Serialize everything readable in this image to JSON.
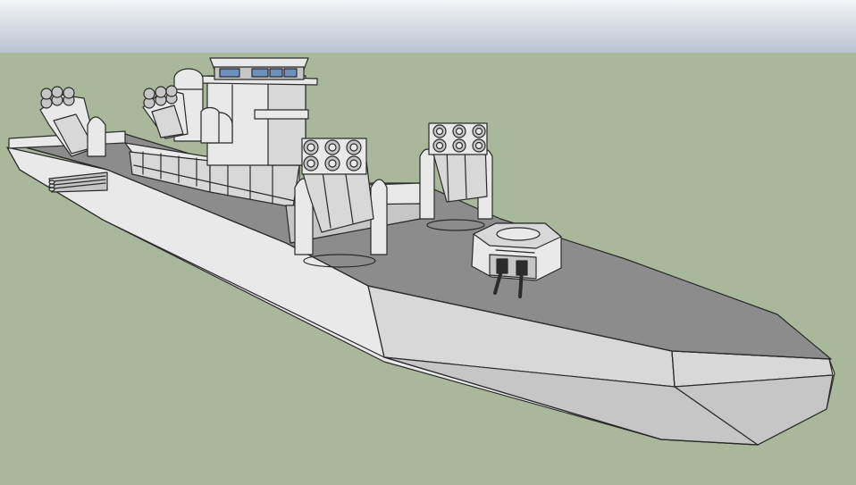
{
  "viewport": {
    "label": "",
    "colors": {
      "sky_top": "#b7c2cf",
      "sky_bottom": "#f4f6f8",
      "ground": "#a9b89a",
      "deck": "#8c8c8c",
      "hull_light": "#e9e9e9",
      "hull_mid": "#d8d8d8",
      "hull_dark": "#c6c6c6",
      "edge": "#2b2b2b",
      "window": "#6d8fbd"
    }
  },
  "model": {
    "name": "",
    "parts": [
      "hull",
      "deck",
      "superstructure",
      "bridge-tower",
      "radome",
      "missile-launcher-forward",
      "missile-launcher-port",
      "missile-launcher-aft-left",
      "missile-launcher-aft-right",
      "gun-turret",
      "torpedo-tubes"
    ]
  }
}
